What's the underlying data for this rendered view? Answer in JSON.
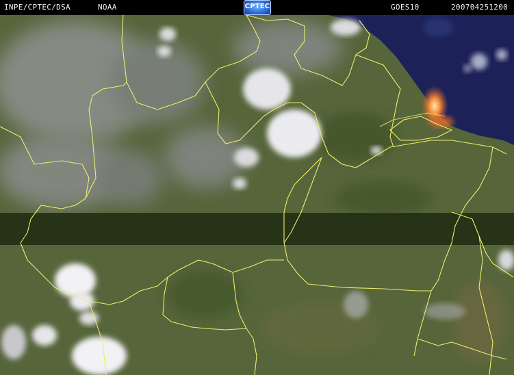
{
  "header": {
    "source": "INPE/CPTEC/DSA",
    "agency": "NOAA",
    "logo_text": "CPTEC",
    "satellite": "GOES10",
    "timestamp": "200704251200"
  },
  "colors": {
    "land": "#5b6a3c",
    "land_dark": "#3d4c25",
    "ocean": "#1c2258",
    "cloud": "#e8e8ec",
    "border": "#f0f07a",
    "coast_hot": "#f07a2c",
    "band_dark": "#1d2a10"
  }
}
